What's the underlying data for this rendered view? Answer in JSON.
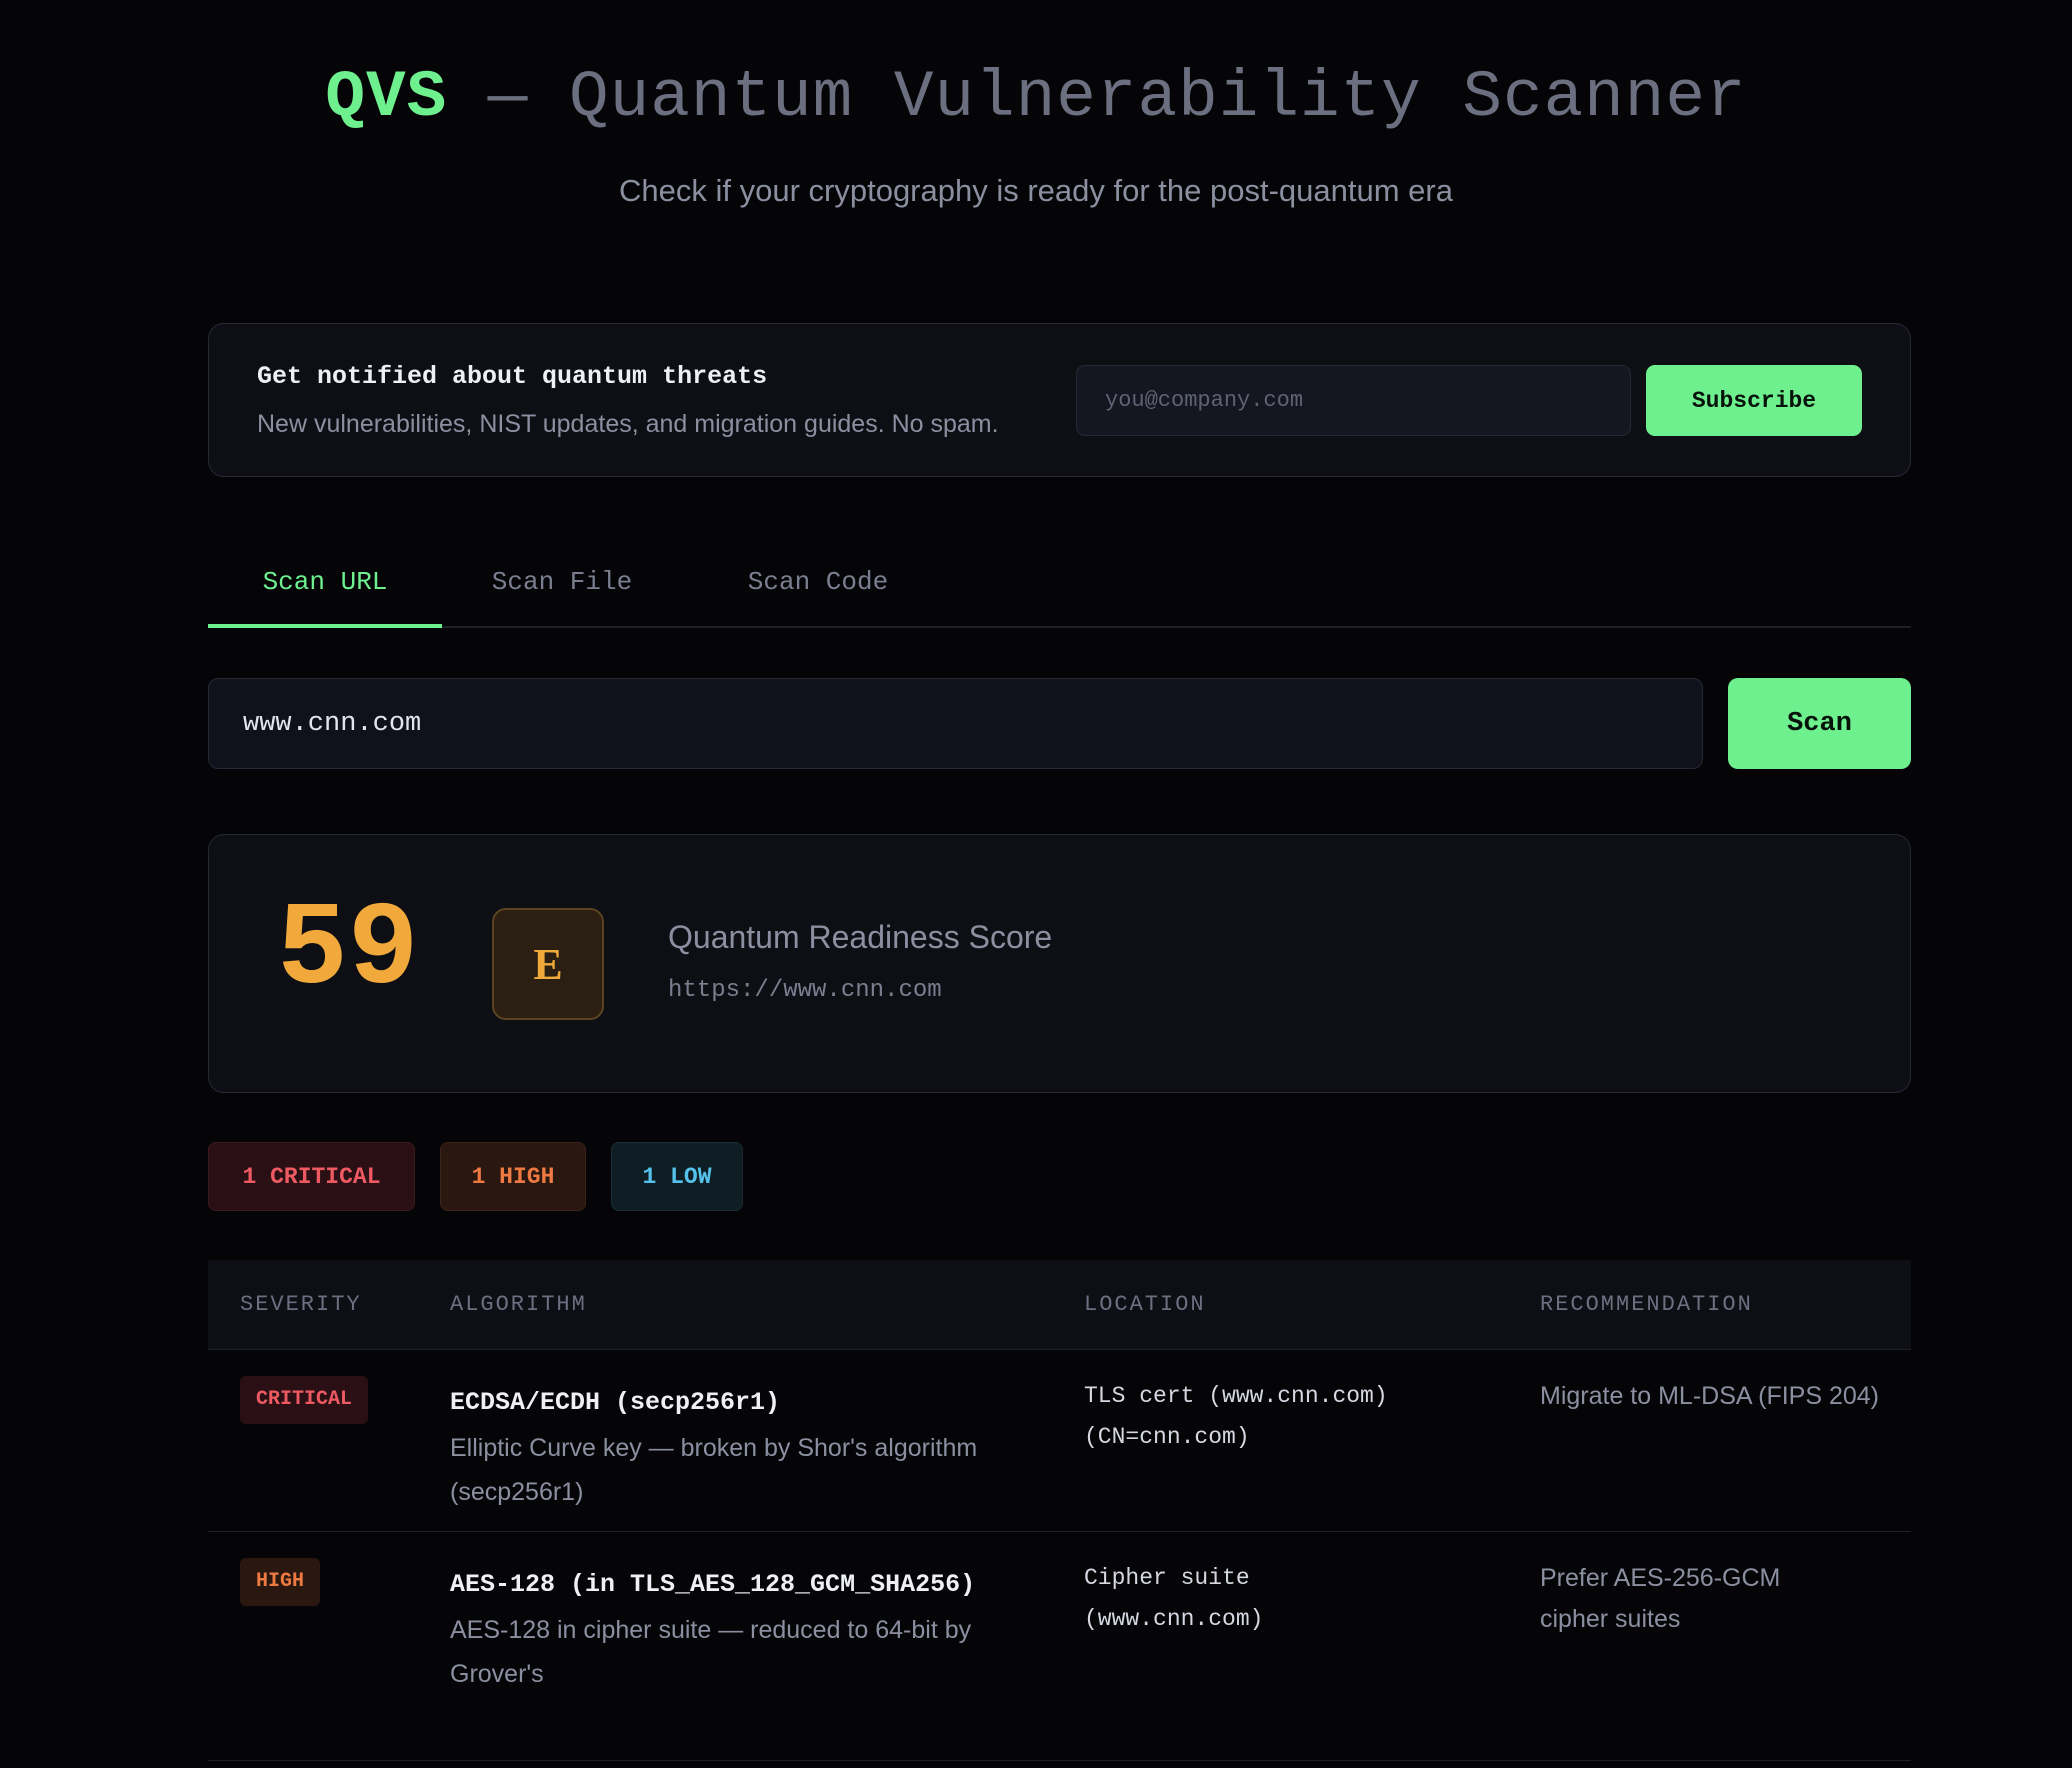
{
  "header": {
    "brand": "QVS",
    "title_rest": " — Quantum Vulnerability Scanner",
    "subtitle": "Check if your cryptography is ready for the post-quantum era"
  },
  "subscribe": {
    "title": "Get notified about quantum threats",
    "description": "New vulnerabilities, NIST updates, and migration guides. No spam.",
    "email_placeholder": "you@company.com",
    "email_value": "",
    "button_label": "Subscribe"
  },
  "tabs": [
    {
      "label": "Scan URL",
      "active": true
    },
    {
      "label": "Scan File",
      "active": false
    },
    {
      "label": "Scan Code",
      "active": false
    }
  ],
  "scan": {
    "input_value": "www.cnn.com",
    "button_label": "Scan"
  },
  "score": {
    "value": "59",
    "grade": "E",
    "label": "Quantum Readiness Score",
    "url": "https://www.cnn.com"
  },
  "summary": {
    "critical": "1 CRITICAL",
    "high": "1 HIGH",
    "low": "1 LOW"
  },
  "table": {
    "headers": [
      "SEVERITY",
      "ALGORITHM",
      "LOCATION",
      "RECOMMENDATION"
    ],
    "rows": [
      {
        "severity": "CRITICAL",
        "algorithm": "ECDSA/ECDH (secp256r1)",
        "description": "Elliptic Curve key — broken by Shor's algorithm (secp256r1)",
        "location": "TLS cert (www.cnn.com)\n(CN=cnn.com)",
        "recommendation": "Migrate to ML-DSA (FIPS 204)"
      },
      {
        "severity": "HIGH",
        "algorithm": "AES-128 (in TLS_AES_128_GCM_SHA256)",
        "description": "AES-128 in cipher suite — reduced to 64-bit by Grover's",
        "location": "Cipher suite\n(www.cnn.com)",
        "recommendation": "Prefer AES-256-GCM cipher suites"
      }
    ]
  },
  "colors": {
    "accent": "#6ef08e",
    "critical": "#ef5a62",
    "high": "#ee7a42",
    "low": "#54c2ea",
    "score": "#f0a93a"
  }
}
